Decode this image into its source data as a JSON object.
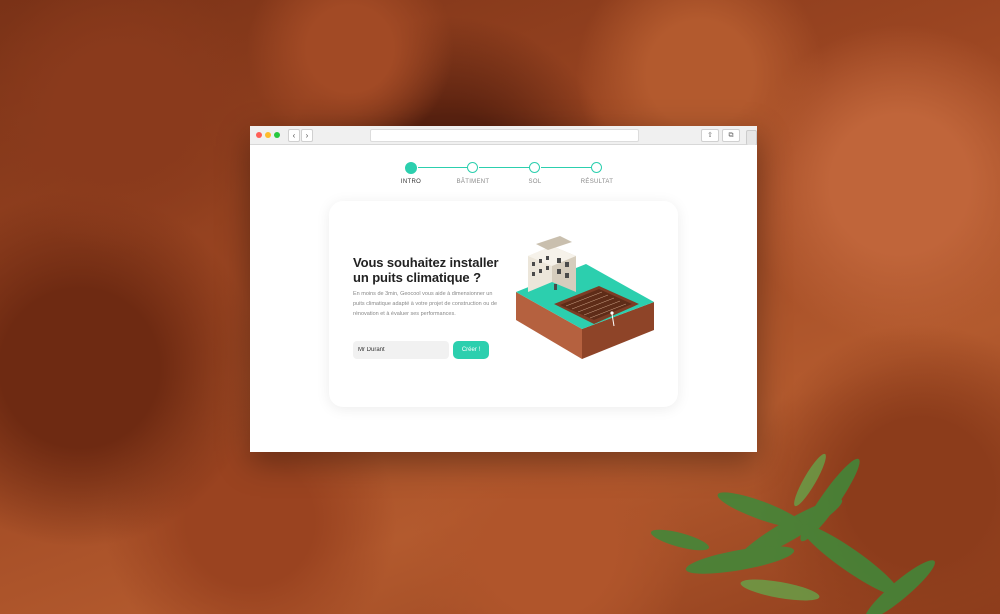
{
  "steps": [
    {
      "label": "INTRO",
      "active": true
    },
    {
      "label": "BÂTIMENT",
      "active": false
    },
    {
      "label": "SOL",
      "active": false
    },
    {
      "label": "RÉSULTAT",
      "active": false
    }
  ],
  "intro": {
    "title": "Vous souhaitez installer un puits climatique ?",
    "description": "En moins de 3min, Geocool vous aide à dimensionner un puits climatique adapté à votre projet de construction ou de rénovation et à évaluer ses performances.",
    "name_value": "Mr Durant",
    "create_label": "Créer !"
  },
  "colors": {
    "accent": "#2ccfae",
    "traffic_red": "#ff5f57",
    "traffic_yellow": "#febc2e",
    "traffic_green": "#28c840"
  },
  "icons": {
    "nav_back": "chevron-left-icon",
    "nav_forward": "chevron-right-icon",
    "share": "share-icon",
    "tabs": "tabs-icon"
  }
}
